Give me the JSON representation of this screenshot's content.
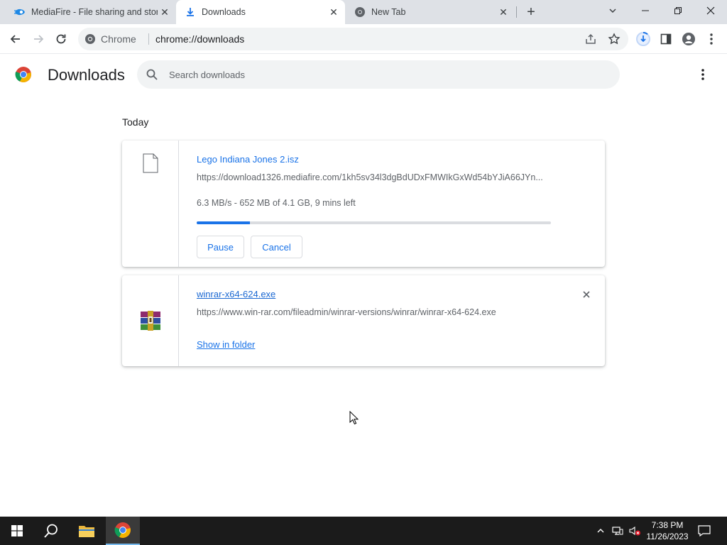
{
  "tabs": [
    {
      "title": "MediaFire - File sharing and storage"
    },
    {
      "title": "Downloads"
    },
    {
      "title": "New Tab"
    }
  ],
  "omnibox": {
    "chrome_label": "Chrome",
    "url": "chrome://downloads"
  },
  "page": {
    "title": "Downloads",
    "search_placeholder": "Search downloads",
    "section_date": "Today"
  },
  "downloads": [
    {
      "filename": "Lego Indiana Jones 2.isz",
      "url": "https://download1326.mediafire.com/1kh5sv34l3dgBdUDxFMWIkGxWd54bYJiA66JYn...",
      "status": "6.3 MB/s - 652 MB of 4.1 GB, 9 mins left",
      "progress_percent": 15,
      "pause_label": "Pause",
      "cancel_label": "Cancel"
    },
    {
      "filename": "winrar-x64-624.exe",
      "url": "https://www.win-rar.com/fileadmin/winrar-versions/winrar/winrar-x64-624.exe",
      "show_in_folder_label": "Show in folder"
    }
  ],
  "taskbar": {
    "time": "7:38 PM",
    "date": "11/26/2023"
  },
  "colors": {
    "accent": "#1a73e8",
    "tabstrip": "#dee1e6",
    "taskbar": "#1b1b1b"
  }
}
